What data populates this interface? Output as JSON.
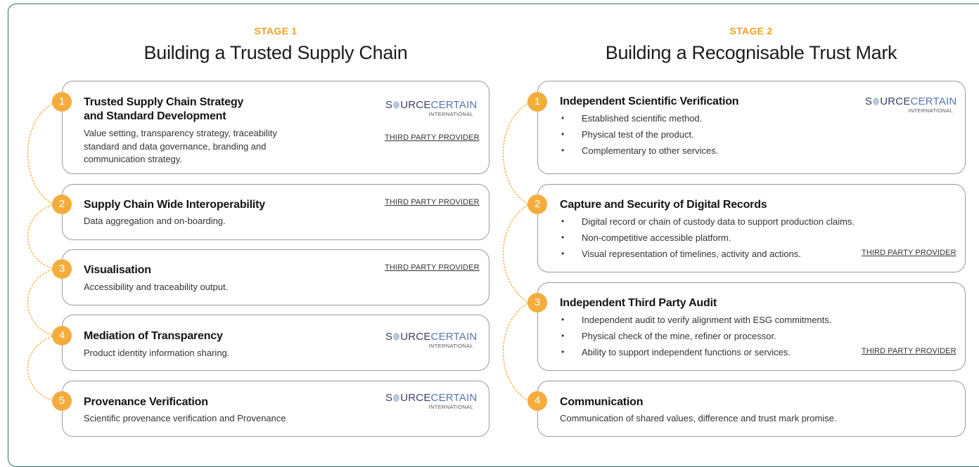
{
  "stages": [
    {
      "label": "STAGE 1",
      "title": "Building a Trusted Supply Chain",
      "steps": [
        {
          "number": "1",
          "title_line1": "Trusted Supply Chain Strategy",
          "title_line2": "and Standard Development",
          "desc_lines": [
            "Value setting, transparency strategy, traceability",
            "standard and data governance, branding and",
            "communication strategy."
          ],
          "logo": true,
          "provider": "THIRD PARTY PROVIDER"
        },
        {
          "number": "2",
          "title_line1": "Supply Chain Wide Interoperability",
          "desc_lines": [
            "Data aggregation and on-boarding."
          ],
          "logo": false,
          "provider": "THIRD PARTY PROVIDER"
        },
        {
          "number": "3",
          "title_line1": "Visualisation",
          "desc_lines": [
            "Accessibility and traceability output."
          ],
          "logo": false,
          "provider": "THIRD PARTY PROVIDER"
        },
        {
          "number": "4",
          "title_line1": "Mediation of Transparency",
          "desc_lines": [
            "Product identity information sharing."
          ],
          "logo": true
        },
        {
          "number": "5",
          "title_line1": "Provenance Verification",
          "desc_lines": [
            "Scientific provenance verification and Provenance"
          ],
          "logo": true
        }
      ]
    },
    {
      "label": "STAGE 2",
      "title": "Building a Recognisable Trust Mark",
      "steps": [
        {
          "number": "1",
          "title_line1": "Independent Scientific Verification",
          "bullets": [
            "Established scientific method.",
            "Physical test of the product.",
            "Complementary to other services."
          ],
          "logo": true
        },
        {
          "number": "2",
          "title_line1": "Capture and Security of Digital Records",
          "bullets": [
            "Digital record or chain of custody data to support production claims.",
            "Non-competitive accessible platform.",
            "Visual representation of timelines, activity and actions."
          ],
          "provider": "THIRD PARTY PROVIDER"
        },
        {
          "number": "3",
          "title_line1": "Independent Third Party Audit",
          "bullets": [
            "Independent audit to verify alignment with ESG commitments.",
            "Physical check of the mine, refiner or processor.",
            "Ability to support independent functions or services."
          ],
          "provider": "THIRD PARTY PROVIDER"
        },
        {
          "number": "4",
          "title_line1": "Communication",
          "desc_lines": [
            "Communication of shared values, difference and trust mark promise."
          ]
        }
      ]
    }
  ],
  "logo": {
    "part1": "S",
    "part2": "URCE",
    "part3": "CERTAIN",
    "sub": "INTERNATIONAL"
  },
  "colors": {
    "accent": "#f4ad3d",
    "stage_label": "#f0a020",
    "frame": "#2f6e5c",
    "logo_dark": "#3a3f66",
    "logo_blue": "#5476b0"
  }
}
